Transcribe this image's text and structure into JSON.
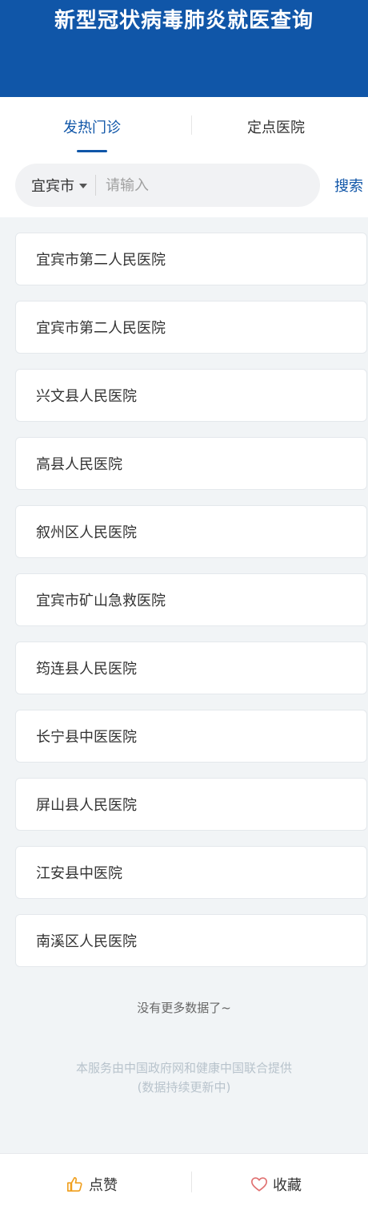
{
  "header": {
    "title": "新型冠状病毒肺炎就医查询"
  },
  "tabs": [
    {
      "label": "发热门诊",
      "active": true
    },
    {
      "label": "定点医院",
      "active": false
    }
  ],
  "search": {
    "city": "宜宾市",
    "placeholder": "请输入",
    "value": "",
    "button_label": "搜索"
  },
  "hospitals": [
    "宜宾市第二人民医院",
    "宜宾市第二人民医院",
    "兴文县人民医院",
    "高县人民医院",
    "叙州区人民医院",
    "宜宾市矿山急救医院",
    "筠连县人民医院",
    "长宁县中医医院",
    "屏山县人民医院",
    "江安县中医院",
    "南溪区人民医院"
  ],
  "footer": {
    "no_more": "没有更多数据了~",
    "provider_line1": "本服务由中国政府网和健康中国联合提供",
    "provider_line2": "(数据持续更新中)"
  },
  "bottom_bar": {
    "like_label": "点赞",
    "like_icon": "thumbs-up-icon",
    "like_color": "#f0a020",
    "favorite_label": "收藏",
    "favorite_icon": "heart-icon",
    "favorite_color": "#e07070"
  },
  "colors": {
    "primary": "#1056a8",
    "background": "#f1f4f6"
  }
}
